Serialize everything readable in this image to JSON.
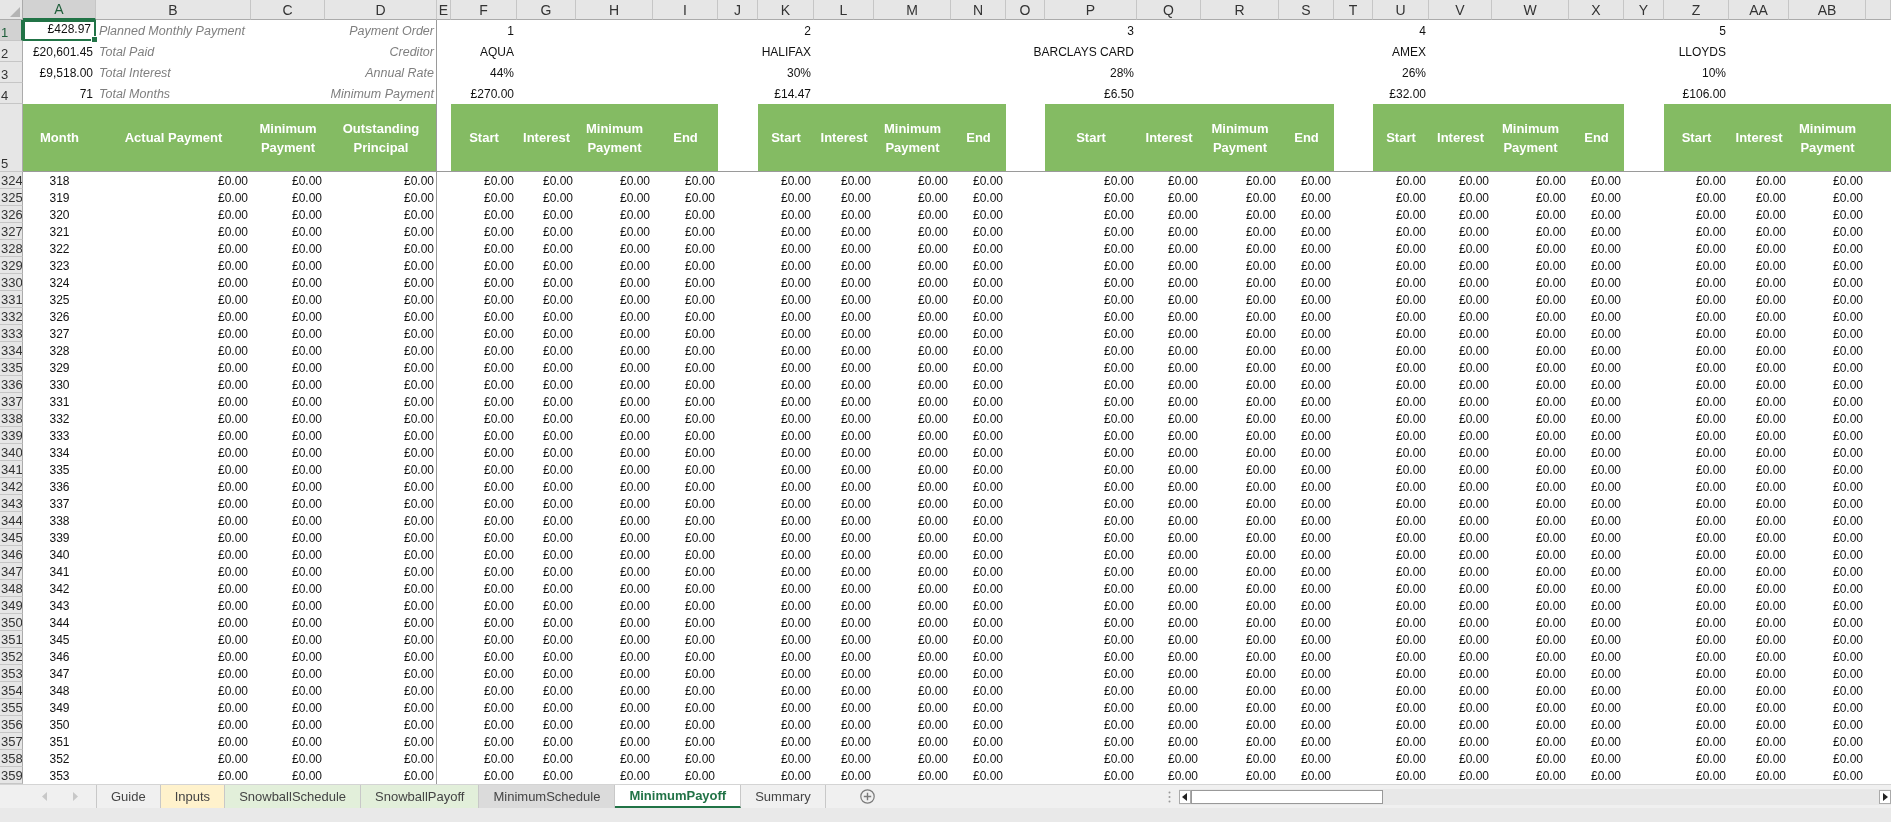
{
  "column_headers": [
    {
      "label": "A",
      "selected": true
    },
    {
      "label": "B",
      "selected": false
    },
    {
      "label": "C",
      "selected": false
    },
    {
      "label": "D",
      "selected": false
    },
    {
      "label": "E",
      "selected": false
    },
    {
      "label": "F",
      "selected": false
    },
    {
      "label": "G",
      "selected": false
    },
    {
      "label": "H",
      "selected": false
    },
    {
      "label": "I",
      "selected": false
    },
    {
      "label": "J",
      "selected": false
    },
    {
      "label": "K",
      "selected": false
    },
    {
      "label": "L",
      "selected": false
    },
    {
      "label": "M",
      "selected": false
    },
    {
      "label": "N",
      "selected": false
    },
    {
      "label": "O",
      "selected": false
    },
    {
      "label": "P",
      "selected": false
    },
    {
      "label": "Q",
      "selected": false
    },
    {
      "label": "R",
      "selected": false
    },
    {
      "label": "S",
      "selected": false
    },
    {
      "label": "T",
      "selected": false
    },
    {
      "label": "U",
      "selected": false
    },
    {
      "label": "V",
      "selected": false
    },
    {
      "label": "W",
      "selected": false
    },
    {
      "label": "X",
      "selected": false
    },
    {
      "label": "Y",
      "selected": false
    },
    {
      "label": "Z",
      "selected": false
    },
    {
      "label": "AA",
      "selected": false
    },
    {
      "label": "AB",
      "selected": false
    }
  ],
  "summary": [
    {
      "row": "1",
      "amount": "£428.97",
      "description": "Planned Monthly Payment",
      "selected": true
    },
    {
      "row": "2",
      "amount": "£20,601.45",
      "description": "Total Paid",
      "selected": false
    },
    {
      "row": "3",
      "amount": "£9,518.00",
      "description": "Total Interest",
      "selected": false
    },
    {
      "row": "4",
      "amount": "71",
      "description": "Total Months",
      "selected": false
    }
  ],
  "creditor_labels": [
    "Payment Order",
    "Creditor",
    "Annual Rate",
    "Minimum Payment"
  ],
  "creditors": [
    {
      "order": "1",
      "name": "AQUA",
      "rate": "44%",
      "minimum": "£270.00",
      "headers": [
        "Start",
        "Interest",
        "Minimum Payment",
        "End"
      ]
    },
    {
      "order": "2",
      "name": "HALIFAX",
      "rate": "30%",
      "minimum": "£14.47",
      "headers": [
        "Start",
        "Interest",
        "Minimum Payment",
        "End"
      ]
    },
    {
      "order": "3",
      "name": "BARCLAYS CARD",
      "rate": "28%",
      "minimum": "£6.50",
      "headers": [
        "Start",
        "Interest",
        "Minimum Payment",
        "End"
      ]
    },
    {
      "order": "4",
      "name": "AMEX",
      "rate": "26%",
      "minimum": "£32.00",
      "headers": [
        "Start",
        "Interest",
        "Minimum Payment",
        "End"
      ]
    },
    {
      "order": "5",
      "name": "LLOYDS",
      "rate": "10%",
      "minimum": "£106.00",
      "headers": [
        "Start",
        "Interest",
        "Minimum Payment"
      ]
    }
  ],
  "header_row": "5",
  "main_headers": [
    "Month",
    "Actual Payment",
    "Minimum Payment",
    "Outstanding Principal"
  ],
  "rows": [
    {
      "row": "324",
      "month": "318",
      "totals": [
        "£0.00",
        "£0.00",
        "£0.00"
      ],
      "creditors": [
        [
          "£0.00",
          "£0.00",
          "£0.00",
          "£0.00"
        ],
        [
          "£0.00",
          "£0.00",
          "£0.00",
          "£0.00"
        ],
        [
          "£0.00",
          "£0.00",
          "£0.00",
          "£0.00"
        ],
        [
          "£0.00",
          "£0.00",
          "£0.00",
          "£0.00"
        ],
        [
          "£0.00",
          "£0.00",
          "£0.00"
        ]
      ]
    },
    {
      "row": "325",
      "month": "319",
      "totals": [
        "£0.00",
        "£0.00",
        "£0.00"
      ],
      "creditors": [
        [
          "£0.00",
          "£0.00",
          "£0.00",
          "£0.00"
        ],
        [
          "£0.00",
          "£0.00",
          "£0.00",
          "£0.00"
        ],
        [
          "£0.00",
          "£0.00",
          "£0.00",
          "£0.00"
        ],
        [
          "£0.00",
          "£0.00",
          "£0.00",
          "£0.00"
        ],
        [
          "£0.00",
          "£0.00",
          "£0.00"
        ]
      ]
    },
    {
      "row": "326",
      "month": "320",
      "totals": [
        "£0.00",
        "£0.00",
        "£0.00"
      ],
      "creditors": [
        [
          "£0.00",
          "£0.00",
          "£0.00",
          "£0.00"
        ],
        [
          "£0.00",
          "£0.00",
          "£0.00",
          "£0.00"
        ],
        [
          "£0.00",
          "£0.00",
          "£0.00",
          "£0.00"
        ],
        [
          "£0.00",
          "£0.00",
          "£0.00",
          "£0.00"
        ],
        [
          "£0.00",
          "£0.00",
          "£0.00"
        ]
      ]
    },
    {
      "row": "327",
      "month": "321",
      "totals": [
        "£0.00",
        "£0.00",
        "£0.00"
      ],
      "creditors": [
        [
          "£0.00",
          "£0.00",
          "£0.00",
          "£0.00"
        ],
        [
          "£0.00",
          "£0.00",
          "£0.00",
          "£0.00"
        ],
        [
          "£0.00",
          "£0.00",
          "£0.00",
          "£0.00"
        ],
        [
          "£0.00",
          "£0.00",
          "£0.00",
          "£0.00"
        ],
        [
          "£0.00",
          "£0.00",
          "£0.00"
        ]
      ]
    },
    {
      "row": "328",
      "month": "322",
      "totals": [
        "£0.00",
        "£0.00",
        "£0.00"
      ],
      "creditors": [
        [
          "£0.00",
          "£0.00",
          "£0.00",
          "£0.00"
        ],
        [
          "£0.00",
          "£0.00",
          "£0.00",
          "£0.00"
        ],
        [
          "£0.00",
          "£0.00",
          "£0.00",
          "£0.00"
        ],
        [
          "£0.00",
          "£0.00",
          "£0.00",
          "£0.00"
        ],
        [
          "£0.00",
          "£0.00",
          "£0.00"
        ]
      ]
    },
    {
      "row": "329",
      "month": "323",
      "totals": [
        "£0.00",
        "£0.00",
        "£0.00"
      ],
      "creditors": [
        [
          "£0.00",
          "£0.00",
          "£0.00",
          "£0.00"
        ],
        [
          "£0.00",
          "£0.00",
          "£0.00",
          "£0.00"
        ],
        [
          "£0.00",
          "£0.00",
          "£0.00",
          "£0.00"
        ],
        [
          "£0.00",
          "£0.00",
          "£0.00",
          "£0.00"
        ],
        [
          "£0.00",
          "£0.00",
          "£0.00"
        ]
      ]
    },
    {
      "row": "330",
      "month": "324",
      "totals": [
        "£0.00",
        "£0.00",
        "£0.00"
      ],
      "creditors": [
        [
          "£0.00",
          "£0.00",
          "£0.00",
          "£0.00"
        ],
        [
          "£0.00",
          "£0.00",
          "£0.00",
          "£0.00"
        ],
        [
          "£0.00",
          "£0.00",
          "£0.00",
          "£0.00"
        ],
        [
          "£0.00",
          "£0.00",
          "£0.00",
          "£0.00"
        ],
        [
          "£0.00",
          "£0.00",
          "£0.00"
        ]
      ]
    },
    {
      "row": "331",
      "month": "325",
      "totals": [
        "£0.00",
        "£0.00",
        "£0.00"
      ],
      "creditors": [
        [
          "£0.00",
          "£0.00",
          "£0.00",
          "£0.00"
        ],
        [
          "£0.00",
          "£0.00",
          "£0.00",
          "£0.00"
        ],
        [
          "£0.00",
          "£0.00",
          "£0.00",
          "£0.00"
        ],
        [
          "£0.00",
          "£0.00",
          "£0.00",
          "£0.00"
        ],
        [
          "£0.00",
          "£0.00",
          "£0.00"
        ]
      ]
    },
    {
      "row": "332",
      "month": "326",
      "totals": [
        "£0.00",
        "£0.00",
        "£0.00"
      ],
      "creditors": [
        [
          "£0.00",
          "£0.00",
          "£0.00",
          "£0.00"
        ],
        [
          "£0.00",
          "£0.00",
          "£0.00",
          "£0.00"
        ],
        [
          "£0.00",
          "£0.00",
          "£0.00",
          "£0.00"
        ],
        [
          "£0.00",
          "£0.00",
          "£0.00",
          "£0.00"
        ],
        [
          "£0.00",
          "£0.00",
          "£0.00"
        ]
      ]
    },
    {
      "row": "333",
      "month": "327",
      "totals": [
        "£0.00",
        "£0.00",
        "£0.00"
      ],
      "creditors": [
        [
          "£0.00",
          "£0.00",
          "£0.00",
          "£0.00"
        ],
        [
          "£0.00",
          "£0.00",
          "£0.00",
          "£0.00"
        ],
        [
          "£0.00",
          "£0.00",
          "£0.00",
          "£0.00"
        ],
        [
          "£0.00",
          "£0.00",
          "£0.00",
          "£0.00"
        ],
        [
          "£0.00",
          "£0.00",
          "£0.00"
        ]
      ]
    },
    {
      "row": "334",
      "month": "328",
      "totals": [
        "£0.00",
        "£0.00",
        "£0.00"
      ],
      "creditors": [
        [
          "£0.00",
          "£0.00",
          "£0.00",
          "£0.00"
        ],
        [
          "£0.00",
          "£0.00",
          "£0.00",
          "£0.00"
        ],
        [
          "£0.00",
          "£0.00",
          "£0.00",
          "£0.00"
        ],
        [
          "£0.00",
          "£0.00",
          "£0.00",
          "£0.00"
        ],
        [
          "£0.00",
          "£0.00",
          "£0.00"
        ]
      ]
    },
    {
      "row": "335",
      "month": "329",
      "totals": [
        "£0.00",
        "£0.00",
        "£0.00"
      ],
      "creditors": [
        [
          "£0.00",
          "£0.00",
          "£0.00",
          "£0.00"
        ],
        [
          "£0.00",
          "£0.00",
          "£0.00",
          "£0.00"
        ],
        [
          "£0.00",
          "£0.00",
          "£0.00",
          "£0.00"
        ],
        [
          "£0.00",
          "£0.00",
          "£0.00",
          "£0.00"
        ],
        [
          "£0.00",
          "£0.00",
          "£0.00"
        ]
      ]
    },
    {
      "row": "336",
      "month": "330",
      "totals": [
        "£0.00",
        "£0.00",
        "£0.00"
      ],
      "creditors": [
        [
          "£0.00",
          "£0.00",
          "£0.00",
          "£0.00"
        ],
        [
          "£0.00",
          "£0.00",
          "£0.00",
          "£0.00"
        ],
        [
          "£0.00",
          "£0.00",
          "£0.00",
          "£0.00"
        ],
        [
          "£0.00",
          "£0.00",
          "£0.00",
          "£0.00"
        ],
        [
          "£0.00",
          "£0.00",
          "£0.00"
        ]
      ]
    },
    {
      "row": "337",
      "month": "331",
      "totals": [
        "£0.00",
        "£0.00",
        "£0.00"
      ],
      "creditors": [
        [
          "£0.00",
          "£0.00",
          "£0.00",
          "£0.00"
        ],
        [
          "£0.00",
          "£0.00",
          "£0.00",
          "£0.00"
        ],
        [
          "£0.00",
          "£0.00",
          "£0.00",
          "£0.00"
        ],
        [
          "£0.00",
          "£0.00",
          "£0.00",
          "£0.00"
        ],
        [
          "£0.00",
          "£0.00",
          "£0.00"
        ]
      ]
    },
    {
      "row": "338",
      "month": "332",
      "totals": [
        "£0.00",
        "£0.00",
        "£0.00"
      ],
      "creditors": [
        [
          "£0.00",
          "£0.00",
          "£0.00",
          "£0.00"
        ],
        [
          "£0.00",
          "£0.00",
          "£0.00",
          "£0.00"
        ],
        [
          "£0.00",
          "£0.00",
          "£0.00",
          "£0.00"
        ],
        [
          "£0.00",
          "£0.00",
          "£0.00",
          "£0.00"
        ],
        [
          "£0.00",
          "£0.00",
          "£0.00"
        ]
      ]
    },
    {
      "row": "339",
      "month": "333",
      "totals": [
        "£0.00",
        "£0.00",
        "£0.00"
      ],
      "creditors": [
        [
          "£0.00",
          "£0.00",
          "£0.00",
          "£0.00"
        ],
        [
          "£0.00",
          "£0.00",
          "£0.00",
          "£0.00"
        ],
        [
          "£0.00",
          "£0.00",
          "£0.00",
          "£0.00"
        ],
        [
          "£0.00",
          "£0.00",
          "£0.00",
          "£0.00"
        ],
        [
          "£0.00",
          "£0.00",
          "£0.00"
        ]
      ]
    },
    {
      "row": "340",
      "month": "334",
      "totals": [
        "£0.00",
        "£0.00",
        "£0.00"
      ],
      "creditors": [
        [
          "£0.00",
          "£0.00",
          "£0.00",
          "£0.00"
        ],
        [
          "£0.00",
          "£0.00",
          "£0.00",
          "£0.00"
        ],
        [
          "£0.00",
          "£0.00",
          "£0.00",
          "£0.00"
        ],
        [
          "£0.00",
          "£0.00",
          "£0.00",
          "£0.00"
        ],
        [
          "£0.00",
          "£0.00",
          "£0.00"
        ]
      ]
    },
    {
      "row": "341",
      "month": "335",
      "totals": [
        "£0.00",
        "£0.00",
        "£0.00"
      ],
      "creditors": [
        [
          "£0.00",
          "£0.00",
          "£0.00",
          "£0.00"
        ],
        [
          "£0.00",
          "£0.00",
          "£0.00",
          "£0.00"
        ],
        [
          "£0.00",
          "£0.00",
          "£0.00",
          "£0.00"
        ],
        [
          "£0.00",
          "£0.00",
          "£0.00",
          "£0.00"
        ],
        [
          "£0.00",
          "£0.00",
          "£0.00"
        ]
      ]
    },
    {
      "row": "342",
      "month": "336",
      "totals": [
        "£0.00",
        "£0.00",
        "£0.00"
      ],
      "creditors": [
        [
          "£0.00",
          "£0.00",
          "£0.00",
          "£0.00"
        ],
        [
          "£0.00",
          "£0.00",
          "£0.00",
          "£0.00"
        ],
        [
          "£0.00",
          "£0.00",
          "£0.00",
          "£0.00"
        ],
        [
          "£0.00",
          "£0.00",
          "£0.00",
          "£0.00"
        ],
        [
          "£0.00",
          "£0.00",
          "£0.00"
        ]
      ]
    },
    {
      "row": "343",
      "month": "337",
      "totals": [
        "£0.00",
        "£0.00",
        "£0.00"
      ],
      "creditors": [
        [
          "£0.00",
          "£0.00",
          "£0.00",
          "£0.00"
        ],
        [
          "£0.00",
          "£0.00",
          "£0.00",
          "£0.00"
        ],
        [
          "£0.00",
          "£0.00",
          "£0.00",
          "£0.00"
        ],
        [
          "£0.00",
          "£0.00",
          "£0.00",
          "£0.00"
        ],
        [
          "£0.00",
          "£0.00",
          "£0.00"
        ]
      ]
    },
    {
      "row": "344",
      "month": "338",
      "totals": [
        "£0.00",
        "£0.00",
        "£0.00"
      ],
      "creditors": [
        [
          "£0.00",
          "£0.00",
          "£0.00",
          "£0.00"
        ],
        [
          "£0.00",
          "£0.00",
          "£0.00",
          "£0.00"
        ],
        [
          "£0.00",
          "£0.00",
          "£0.00",
          "£0.00"
        ],
        [
          "£0.00",
          "£0.00",
          "£0.00",
          "£0.00"
        ],
        [
          "£0.00",
          "£0.00",
          "£0.00"
        ]
      ]
    },
    {
      "row": "345",
      "month": "339",
      "totals": [
        "£0.00",
        "£0.00",
        "£0.00"
      ],
      "creditors": [
        [
          "£0.00",
          "£0.00",
          "£0.00",
          "£0.00"
        ],
        [
          "£0.00",
          "£0.00",
          "£0.00",
          "£0.00"
        ],
        [
          "£0.00",
          "£0.00",
          "£0.00",
          "£0.00"
        ],
        [
          "£0.00",
          "£0.00",
          "£0.00",
          "£0.00"
        ],
        [
          "£0.00",
          "£0.00",
          "£0.00"
        ]
      ]
    },
    {
      "row": "346",
      "month": "340",
      "totals": [
        "£0.00",
        "£0.00",
        "£0.00"
      ],
      "creditors": [
        [
          "£0.00",
          "£0.00",
          "£0.00",
          "£0.00"
        ],
        [
          "£0.00",
          "£0.00",
          "£0.00",
          "£0.00"
        ],
        [
          "£0.00",
          "£0.00",
          "£0.00",
          "£0.00"
        ],
        [
          "£0.00",
          "£0.00",
          "£0.00",
          "£0.00"
        ],
        [
          "£0.00",
          "£0.00",
          "£0.00"
        ]
      ]
    },
    {
      "row": "347",
      "month": "341",
      "totals": [
        "£0.00",
        "£0.00",
        "£0.00"
      ],
      "creditors": [
        [
          "£0.00",
          "£0.00",
          "£0.00",
          "£0.00"
        ],
        [
          "£0.00",
          "£0.00",
          "£0.00",
          "£0.00"
        ],
        [
          "£0.00",
          "£0.00",
          "£0.00",
          "£0.00"
        ],
        [
          "£0.00",
          "£0.00",
          "£0.00",
          "£0.00"
        ],
        [
          "£0.00",
          "£0.00",
          "£0.00"
        ]
      ]
    },
    {
      "row": "348",
      "month": "342",
      "totals": [
        "£0.00",
        "£0.00",
        "£0.00"
      ],
      "creditors": [
        [
          "£0.00",
          "£0.00",
          "£0.00",
          "£0.00"
        ],
        [
          "£0.00",
          "£0.00",
          "£0.00",
          "£0.00"
        ],
        [
          "£0.00",
          "£0.00",
          "£0.00",
          "£0.00"
        ],
        [
          "£0.00",
          "£0.00",
          "£0.00",
          "£0.00"
        ],
        [
          "£0.00",
          "£0.00",
          "£0.00"
        ]
      ]
    },
    {
      "row": "349",
      "month": "343",
      "totals": [
        "£0.00",
        "£0.00",
        "£0.00"
      ],
      "creditors": [
        [
          "£0.00",
          "£0.00",
          "£0.00",
          "£0.00"
        ],
        [
          "£0.00",
          "£0.00",
          "£0.00",
          "£0.00"
        ],
        [
          "£0.00",
          "£0.00",
          "£0.00",
          "£0.00"
        ],
        [
          "£0.00",
          "£0.00",
          "£0.00",
          "£0.00"
        ],
        [
          "£0.00",
          "£0.00",
          "£0.00"
        ]
      ]
    },
    {
      "row": "350",
      "month": "344",
      "totals": [
        "£0.00",
        "£0.00",
        "£0.00"
      ],
      "creditors": [
        [
          "£0.00",
          "£0.00",
          "£0.00",
          "£0.00"
        ],
        [
          "£0.00",
          "£0.00",
          "£0.00",
          "£0.00"
        ],
        [
          "£0.00",
          "£0.00",
          "£0.00",
          "£0.00"
        ],
        [
          "£0.00",
          "£0.00",
          "£0.00",
          "£0.00"
        ],
        [
          "£0.00",
          "£0.00",
          "£0.00"
        ]
      ]
    },
    {
      "row": "351",
      "month": "345",
      "totals": [
        "£0.00",
        "£0.00",
        "£0.00"
      ],
      "creditors": [
        [
          "£0.00",
          "£0.00",
          "£0.00",
          "£0.00"
        ],
        [
          "£0.00",
          "£0.00",
          "£0.00",
          "£0.00"
        ],
        [
          "£0.00",
          "£0.00",
          "£0.00",
          "£0.00"
        ],
        [
          "£0.00",
          "£0.00",
          "£0.00",
          "£0.00"
        ],
        [
          "£0.00",
          "£0.00",
          "£0.00"
        ]
      ]
    },
    {
      "row": "352",
      "month": "346",
      "totals": [
        "£0.00",
        "£0.00",
        "£0.00"
      ],
      "creditors": [
        [
          "£0.00",
          "£0.00",
          "£0.00",
          "£0.00"
        ],
        [
          "£0.00",
          "£0.00",
          "£0.00",
          "£0.00"
        ],
        [
          "£0.00",
          "£0.00",
          "£0.00",
          "£0.00"
        ],
        [
          "£0.00",
          "£0.00",
          "£0.00",
          "£0.00"
        ],
        [
          "£0.00",
          "£0.00",
          "£0.00"
        ]
      ]
    },
    {
      "row": "353",
      "month": "347",
      "totals": [
        "£0.00",
        "£0.00",
        "£0.00"
      ],
      "creditors": [
        [
          "£0.00",
          "£0.00",
          "£0.00",
          "£0.00"
        ],
        [
          "£0.00",
          "£0.00",
          "£0.00",
          "£0.00"
        ],
        [
          "£0.00",
          "£0.00",
          "£0.00",
          "£0.00"
        ],
        [
          "£0.00",
          "£0.00",
          "£0.00",
          "£0.00"
        ],
        [
          "£0.00",
          "£0.00",
          "£0.00"
        ]
      ]
    },
    {
      "row": "354",
      "month": "348",
      "totals": [
        "£0.00",
        "£0.00",
        "£0.00"
      ],
      "creditors": [
        [
          "£0.00",
          "£0.00",
          "£0.00",
          "£0.00"
        ],
        [
          "£0.00",
          "£0.00",
          "£0.00",
          "£0.00"
        ],
        [
          "£0.00",
          "£0.00",
          "£0.00",
          "£0.00"
        ],
        [
          "£0.00",
          "£0.00",
          "£0.00",
          "£0.00"
        ],
        [
          "£0.00",
          "£0.00",
          "£0.00"
        ]
      ]
    },
    {
      "row": "355",
      "month": "349",
      "totals": [
        "£0.00",
        "£0.00",
        "£0.00"
      ],
      "creditors": [
        [
          "£0.00",
          "£0.00",
          "£0.00",
          "£0.00"
        ],
        [
          "£0.00",
          "£0.00",
          "£0.00",
          "£0.00"
        ],
        [
          "£0.00",
          "£0.00",
          "£0.00",
          "£0.00"
        ],
        [
          "£0.00",
          "£0.00",
          "£0.00",
          "£0.00"
        ],
        [
          "£0.00",
          "£0.00",
          "£0.00"
        ]
      ]
    },
    {
      "row": "356",
      "month": "350",
      "totals": [
        "£0.00",
        "£0.00",
        "£0.00"
      ],
      "creditors": [
        [
          "£0.00",
          "£0.00",
          "£0.00",
          "£0.00"
        ],
        [
          "£0.00",
          "£0.00",
          "£0.00",
          "£0.00"
        ],
        [
          "£0.00",
          "£0.00",
          "£0.00",
          "£0.00"
        ],
        [
          "£0.00",
          "£0.00",
          "£0.00",
          "£0.00"
        ],
        [
          "£0.00",
          "£0.00",
          "£0.00"
        ]
      ]
    },
    {
      "row": "357",
      "month": "351",
      "totals": [
        "£0.00",
        "£0.00",
        "£0.00"
      ],
      "creditors": [
        [
          "£0.00",
          "£0.00",
          "£0.00",
          "£0.00"
        ],
        [
          "£0.00",
          "£0.00",
          "£0.00",
          "£0.00"
        ],
        [
          "£0.00",
          "£0.00",
          "£0.00",
          "£0.00"
        ],
        [
          "£0.00",
          "£0.00",
          "£0.00",
          "£0.00"
        ],
        [
          "£0.00",
          "£0.00",
          "£0.00"
        ]
      ]
    },
    {
      "row": "358",
      "month": "352",
      "totals": [
        "£0.00",
        "£0.00",
        "£0.00"
      ],
      "creditors": [
        [
          "£0.00",
          "£0.00",
          "£0.00",
          "£0.00"
        ],
        [
          "£0.00",
          "£0.00",
          "£0.00",
          "£0.00"
        ],
        [
          "£0.00",
          "£0.00",
          "£0.00",
          "£0.00"
        ],
        [
          "£0.00",
          "£0.00",
          "£0.00",
          "£0.00"
        ],
        [
          "£0.00",
          "£0.00",
          "£0.00"
        ]
      ]
    },
    {
      "row": "359",
      "month": "353",
      "totals": [
        "£0.00",
        "£0.00",
        "£0.00"
      ],
      "creditors": [
        [
          "£0.00",
          "£0.00",
          "£0.00",
          "£0.00"
        ],
        [
          "£0.00",
          "£0.00",
          "£0.00",
          "£0.00"
        ],
        [
          "£0.00",
          "£0.00",
          "£0.00",
          "£0.00"
        ],
        [
          "£0.00",
          "£0.00",
          "£0.00",
          "£0.00"
        ],
        [
          "£0.00",
          "£0.00",
          "£0.00"
        ]
      ]
    }
  ],
  "sheet_tabs": [
    {
      "label": "Guide",
      "selected": false
    },
    {
      "label": "Inputs",
      "selected": false,
      "color": "#fff2cc"
    },
    {
      "label": "SnowballSchedule",
      "selected": false,
      "color": "#e2efda"
    },
    {
      "label": "SnowballPayoff",
      "selected": false,
      "color": "#e2efda"
    },
    {
      "label": "MinimumSchedule",
      "selected": false,
      "color": "#dbdbdb"
    },
    {
      "label": "MinimumPayoff",
      "selected": true
    },
    {
      "label": "Summary",
      "selected": false
    }
  ]
}
